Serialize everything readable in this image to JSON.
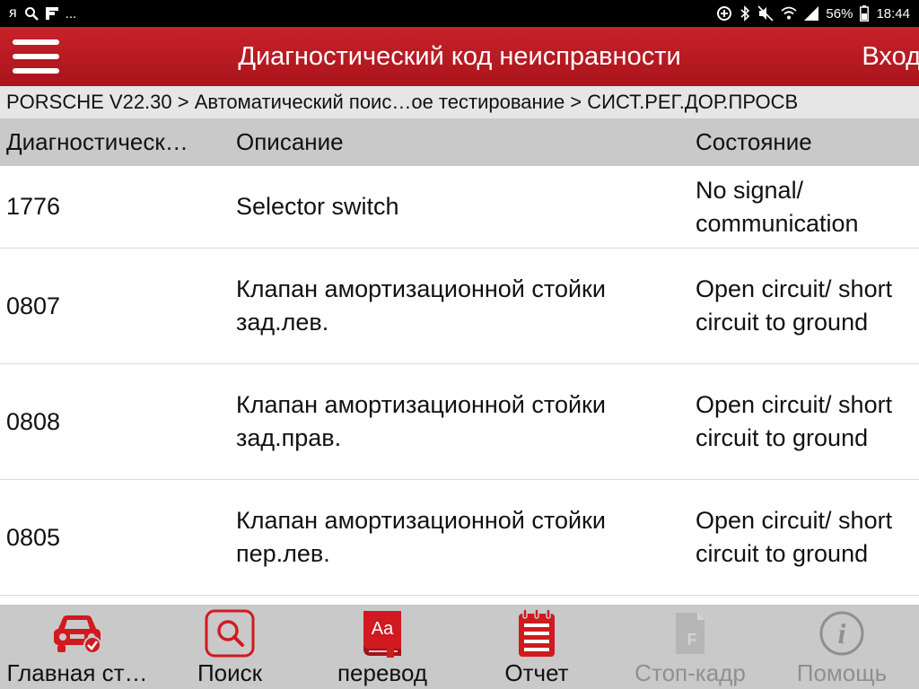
{
  "status_bar": {
    "left_icons": [
      "yandex-icon",
      "search-icon",
      "flipboard-icon",
      "more-icon"
    ],
    "yandex_glyph": "я",
    "more_glyph": "...",
    "battery": "56%",
    "time": "18:44"
  },
  "header": {
    "title": "Диагностический код неисправности",
    "login": "Вход"
  },
  "breadcrumb": "PORSCHE V22.30 > Автоматический поис…ое тестирование > СИСТ.РЕГ.ДОР.ПРОСВ",
  "table": {
    "headers": [
      "Диагностическ…",
      "Описание",
      "Состояние"
    ],
    "rows": [
      {
        "code": "1776",
        "description": "Selector switch",
        "status": "No signal/ communication"
      },
      {
        "code": "0807",
        "description": "Клапан амортизационной стойки зад.лев.",
        "status": "Open circuit/ short circuit to ground"
      },
      {
        "code": "0808",
        "description": "Клапан амортизационной стойки зад.прав.",
        "status": "Open circuit/ short circuit to ground"
      },
      {
        "code": "0805",
        "description": "Клапан амортизационной стойки пер.лев.",
        "status": "Open circuit/ short circuit to ground"
      }
    ]
  },
  "bottom_nav": [
    {
      "label": "Главная ст…",
      "icon": "car-home-icon",
      "enabled": true
    },
    {
      "label": "Поиск",
      "icon": "search-icon",
      "enabled": true
    },
    {
      "label": "перевод",
      "icon": "translate-icon",
      "enabled": true
    },
    {
      "label": "Отчет",
      "icon": "report-icon",
      "enabled": true
    },
    {
      "label": "Стоп-кадр",
      "icon": "freeze-frame-icon",
      "enabled": false
    },
    {
      "label": "Помощь",
      "icon": "help-icon",
      "enabled": false
    }
  ],
  "colors": {
    "accent": "#c0161e",
    "header_bg": "#c9c9c9",
    "disabled": "#8f8f8f"
  }
}
